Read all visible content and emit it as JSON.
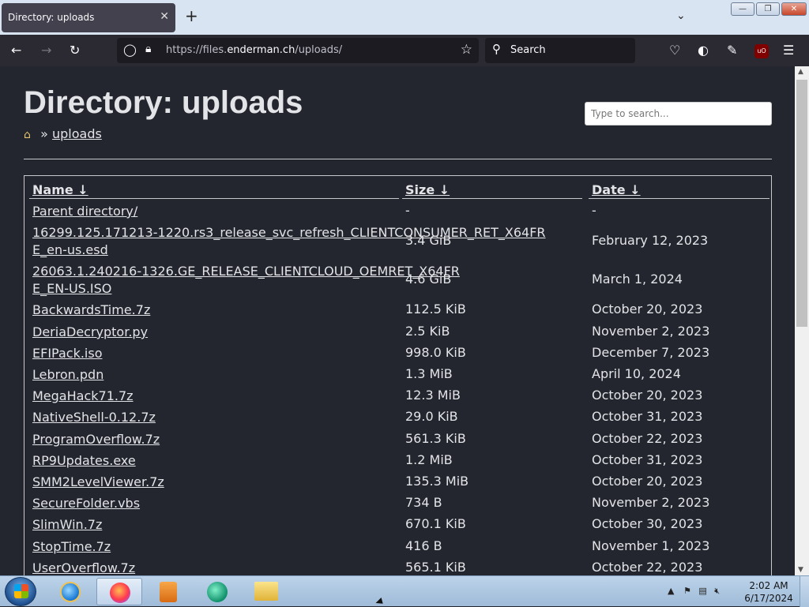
{
  "browser": {
    "tab_title": "Directory: uploads",
    "tab_close": "✕",
    "new_tab": "+",
    "url_scheme": "https://files.",
    "url_host": "enderman.ch",
    "url_path": "/uploads/",
    "search_placeholder": "Search"
  },
  "page": {
    "title": "Directory: uploads",
    "search_placeholder": "Type to search...",
    "breadcrumb_sep": "»",
    "breadcrumb_link": "uploads",
    "columns": {
      "name": "Name ↓",
      "size": "Size ↓",
      "date": "Date ↓"
    },
    "files": [
      {
        "name": "Parent directory/",
        "size": "-",
        "date": "-"
      },
      {
        "name": "16299.125.171213-1220.rs3_release_svc_refresh_CLIENTCONSUMER_RET_X64FRE_en-us.esd",
        "size": "3.4 GiB",
        "date": "February 12, 2023"
      },
      {
        "name": "26063.1.240216-1326.GE_RELEASE_CLIENTCLOUD_OEMRET_X64FRE_EN-US.ISO",
        "size": "4.6 GiB",
        "date": "March 1, 2024"
      },
      {
        "name": "BackwardsTime.7z",
        "size": "112.5 KiB",
        "date": "October 20, 2023"
      },
      {
        "name": "DeriaDecryptor.py",
        "size": "2.5 KiB",
        "date": "November 2, 2023"
      },
      {
        "name": "EFIPack.iso",
        "size": "998.0 KiB",
        "date": "December 7, 2023"
      },
      {
        "name": "Lebron.pdn",
        "size": "1.3 MiB",
        "date": "April 10, 2024"
      },
      {
        "name": "MegaHack71.7z",
        "size": "12.3 MiB",
        "date": "October 20, 2023"
      },
      {
        "name": "NativeShell-0.12.7z",
        "size": "29.0 KiB",
        "date": "October 31, 2023"
      },
      {
        "name": "ProgramOverflow.7z",
        "size": "561.3 KiB",
        "date": "October 22, 2023"
      },
      {
        "name": "RP9Updates.exe",
        "size": "1.2 MiB",
        "date": "October 31, 2023"
      },
      {
        "name": "SMM2LevelViewer.7z",
        "size": "135.3 MiB",
        "date": "October 20, 2023"
      },
      {
        "name": "SecureFolder.vbs",
        "size": "734 B",
        "date": "November 2, 2023"
      },
      {
        "name": "SlimWin.7z",
        "size": "670.1 KiB",
        "date": "October 30, 2023"
      },
      {
        "name": "StopTime.7z",
        "size": "416 B",
        "date": "November 1, 2023"
      },
      {
        "name": "UserOverflow.7z",
        "size": "565.1 KiB",
        "date": "October 22, 2023"
      }
    ]
  },
  "taskbar": {
    "time": "2:02 AM",
    "date": "6/17/2024"
  }
}
